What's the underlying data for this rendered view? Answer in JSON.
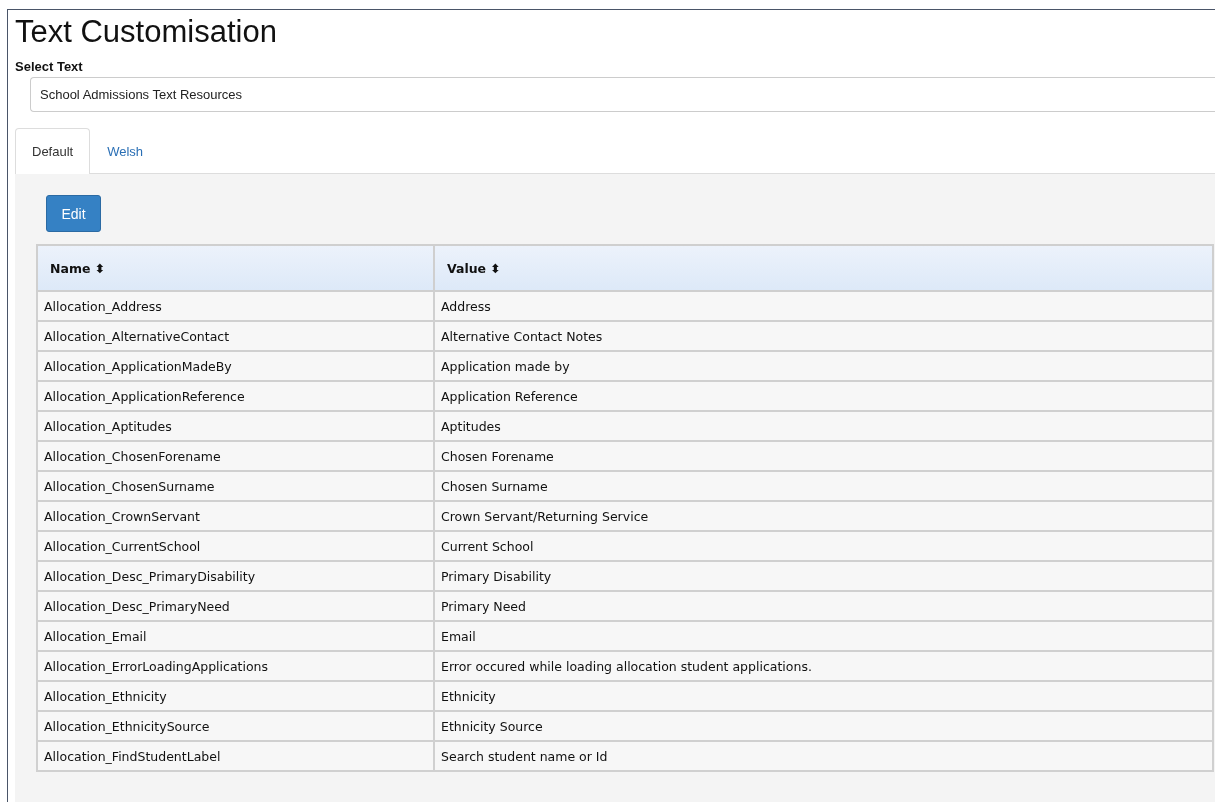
{
  "title": "Text Customisation",
  "select": {
    "label": "Select Text",
    "value": "School Admissions Text Resources"
  },
  "tabs": [
    {
      "label": "Default",
      "selected": true
    },
    {
      "label": "Welsh",
      "selected": false
    }
  ],
  "edit_button": "Edit",
  "table": {
    "columns": [
      {
        "label": "Name",
        "sort_icon": "⬍"
      },
      {
        "label": "Value",
        "sort_icon": "⬍"
      }
    ],
    "rows": [
      [
        "Allocation_Address",
        "Address"
      ],
      [
        "Allocation_AlternativeContact",
        "Alternative Contact Notes"
      ],
      [
        "Allocation_ApplicationMadeBy",
        "Application made by"
      ],
      [
        "Allocation_ApplicationReference",
        "Application Reference"
      ],
      [
        "Allocation_Aptitudes",
        "Aptitudes"
      ],
      [
        "Allocation_ChosenForename",
        "Chosen Forename"
      ],
      [
        "Allocation_ChosenSurname",
        "Chosen Surname"
      ],
      [
        "Allocation_CrownServant",
        "Crown Servant/Returning Service"
      ],
      [
        "Allocation_CurrentSchool",
        "Current School"
      ],
      [
        "Allocation_Desc_PrimaryDisability",
        "Primary Disability"
      ],
      [
        "Allocation_Desc_PrimaryNeed",
        "Primary Need"
      ],
      [
        "Allocation_Email",
        "Email"
      ],
      [
        "Allocation_ErrorLoadingApplications",
        "Error occured while loading allocation student applications."
      ],
      [
        "Allocation_Ethnicity",
        "Ethnicity"
      ],
      [
        "Allocation_EthnicitySource",
        "Ethnicity Source"
      ],
      [
        "Allocation_FindStudentLabel",
        "Search student name or Id"
      ]
    ]
  }
}
